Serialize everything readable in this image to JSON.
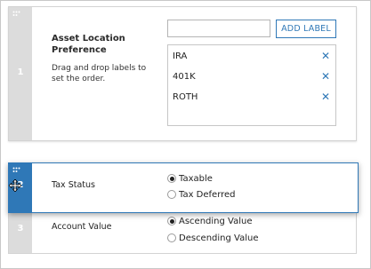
{
  "card1": {
    "number": "1",
    "title": "Asset Location Preference",
    "description": "Drag and drop labels to set the order.",
    "label_input": {
      "value": "",
      "placeholder": ""
    },
    "add_label_button": "ADD LABEL",
    "labels": [
      "IRA",
      "401K",
      "ROTH"
    ],
    "remove_glyph": "✕"
  },
  "card2": {
    "number": "2",
    "title": "Tax Status",
    "options": [
      "Taxable",
      "Tax Deferred"
    ],
    "selected": "Taxable"
  },
  "card3": {
    "number": "3",
    "title": "Account Value",
    "options": [
      "Ascending Value",
      "Descending Value"
    ],
    "selected": "Ascending Value"
  },
  "colors": {
    "accent": "#2f78b7",
    "strip_gray": "#dcdcdc"
  },
  "icons": {
    "drag_handle": "grip-dots-icon",
    "remove": "close-icon",
    "cursor": "move-cursor-icon"
  }
}
